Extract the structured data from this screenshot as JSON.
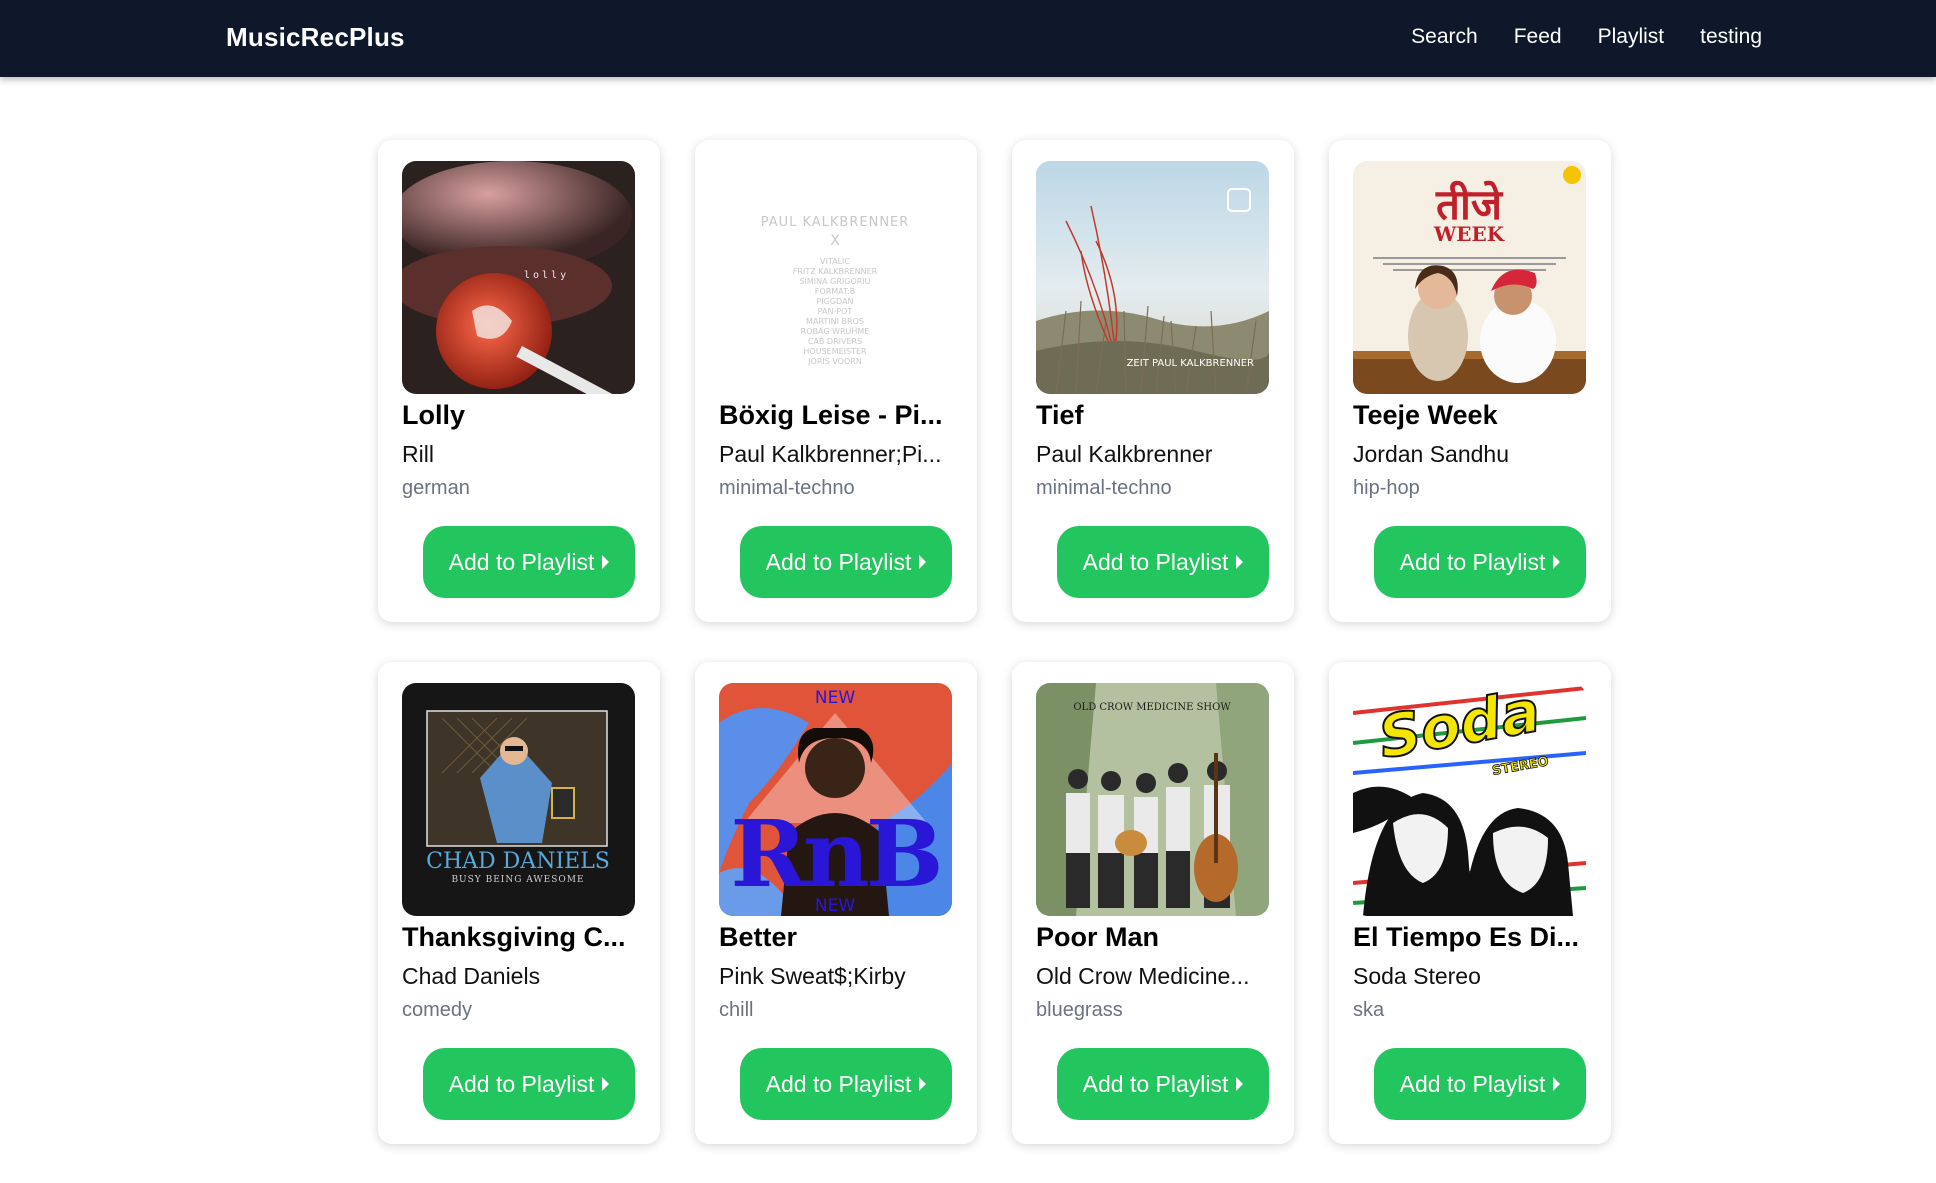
{
  "app": {
    "brand": "MusicRecPlus"
  },
  "nav": [
    "Search",
    "Feed",
    "Playlist",
    "testing"
  ],
  "colors": {
    "navbar": "#0f172a",
    "button": "#22c55e",
    "genre_text": "#6b7280"
  },
  "button_label": "Add to Playlist",
  "cover_text": {
    "lolly": "lolly",
    "paul_header": "PAUL KALKBRENNER",
    "paul_x": "X",
    "paul_list": [
      "VITALIC",
      "FRITZ KALKBRENNER",
      "SIMINA GRIGORIU",
      "FORMAT:B",
      "PIGGDAN",
      "PAN-POT",
      "MARTINI BROS",
      "ROBAG WRUHME",
      "CAB DRIVERS",
      "HOUSEMEISTER",
      "JORIS VOORN"
    ],
    "tief": "ZEIT   PAUL KALKBRENNER",
    "teeje_title": "तीजे",
    "teeje_week": "WEEK",
    "chad_name": "CHAD DANIELS",
    "chad_sub": "BUSY BEING AWESOME",
    "rnb_new_top": "NEW",
    "rnb_big": "RnB",
    "rnb_new_bottom": "NEW",
    "ocms": "OLD CROW MEDICINE SHOW",
    "soda": "Soda",
    "soda_sub": "STEREO"
  },
  "cards": [
    {
      "title": "Lolly",
      "artist": "Rill",
      "genre": "german"
    },
    {
      "title": "Böxig Leise - Pi...",
      "artist": "Paul Kalkbrenner;Pi...",
      "genre": "minimal-techno"
    },
    {
      "title": "Tief",
      "artist": "Paul Kalkbrenner",
      "genre": "minimal-techno"
    },
    {
      "title": "Teeje Week",
      "artist": "Jordan Sandhu",
      "genre": "hip-hop"
    },
    {
      "title": "Thanksgiving C...",
      "artist": "Chad Daniels",
      "genre": "comedy"
    },
    {
      "title": "Better",
      "artist": "Pink Sweat$;Kirby",
      "genre": "chill"
    },
    {
      "title": "Poor Man",
      "artist": "Old Crow Medicine...",
      "genre": "bluegrass"
    },
    {
      "title": "El Tiempo Es Di...",
      "artist": "Soda Stereo",
      "genre": "ska"
    }
  ]
}
